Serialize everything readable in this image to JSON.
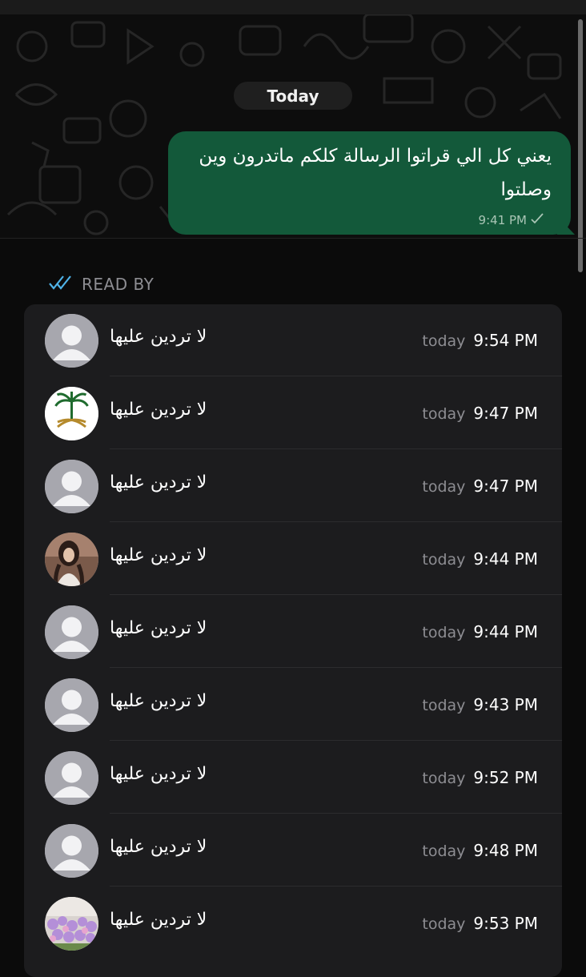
{
  "date_pill": "Today",
  "message": {
    "text": "يعني كل الي قراتوا الرسالة كلكم ماتدرون وين وصلتوا",
    "time": "9:41 PM",
    "status_icon": "single-check-icon"
  },
  "read_by": {
    "label": "READ BY",
    "icon": "double-check-icon",
    "icon_color": "#4fb3e8"
  },
  "readers": [
    {
      "name": "لا تردين عليها",
      "day": "today",
      "time": "9:54 PM",
      "avatar": "default-avatar"
    },
    {
      "name": "لا تردين عليها",
      "day": "today",
      "time": "9:47 PM",
      "avatar": "palm-emblem-avatar"
    },
    {
      "name": "لا تردين عليها",
      "day": "today",
      "time": "9:47 PM",
      "avatar": "default-avatar"
    },
    {
      "name": "لا تردين عليها",
      "day": "today",
      "time": "9:44 PM",
      "avatar": "photo-avatar"
    },
    {
      "name": "لا تردين عليها",
      "day": "today",
      "time": "9:44 PM",
      "avatar": "default-avatar"
    },
    {
      "name": "لا تردين عليها",
      "day": "today",
      "time": "9:43 PM",
      "avatar": "default-avatar"
    },
    {
      "name": "لا تردين عليها",
      "day": "today",
      "time": "9:52 PM",
      "avatar": "default-avatar"
    },
    {
      "name": "لا تردين عليها",
      "day": "today",
      "time": "9:48 PM",
      "avatar": "default-avatar"
    },
    {
      "name": "لا تردين عليها",
      "day": "today",
      "time": "9:53 PM",
      "avatar": "flowers-avatar"
    }
  ]
}
